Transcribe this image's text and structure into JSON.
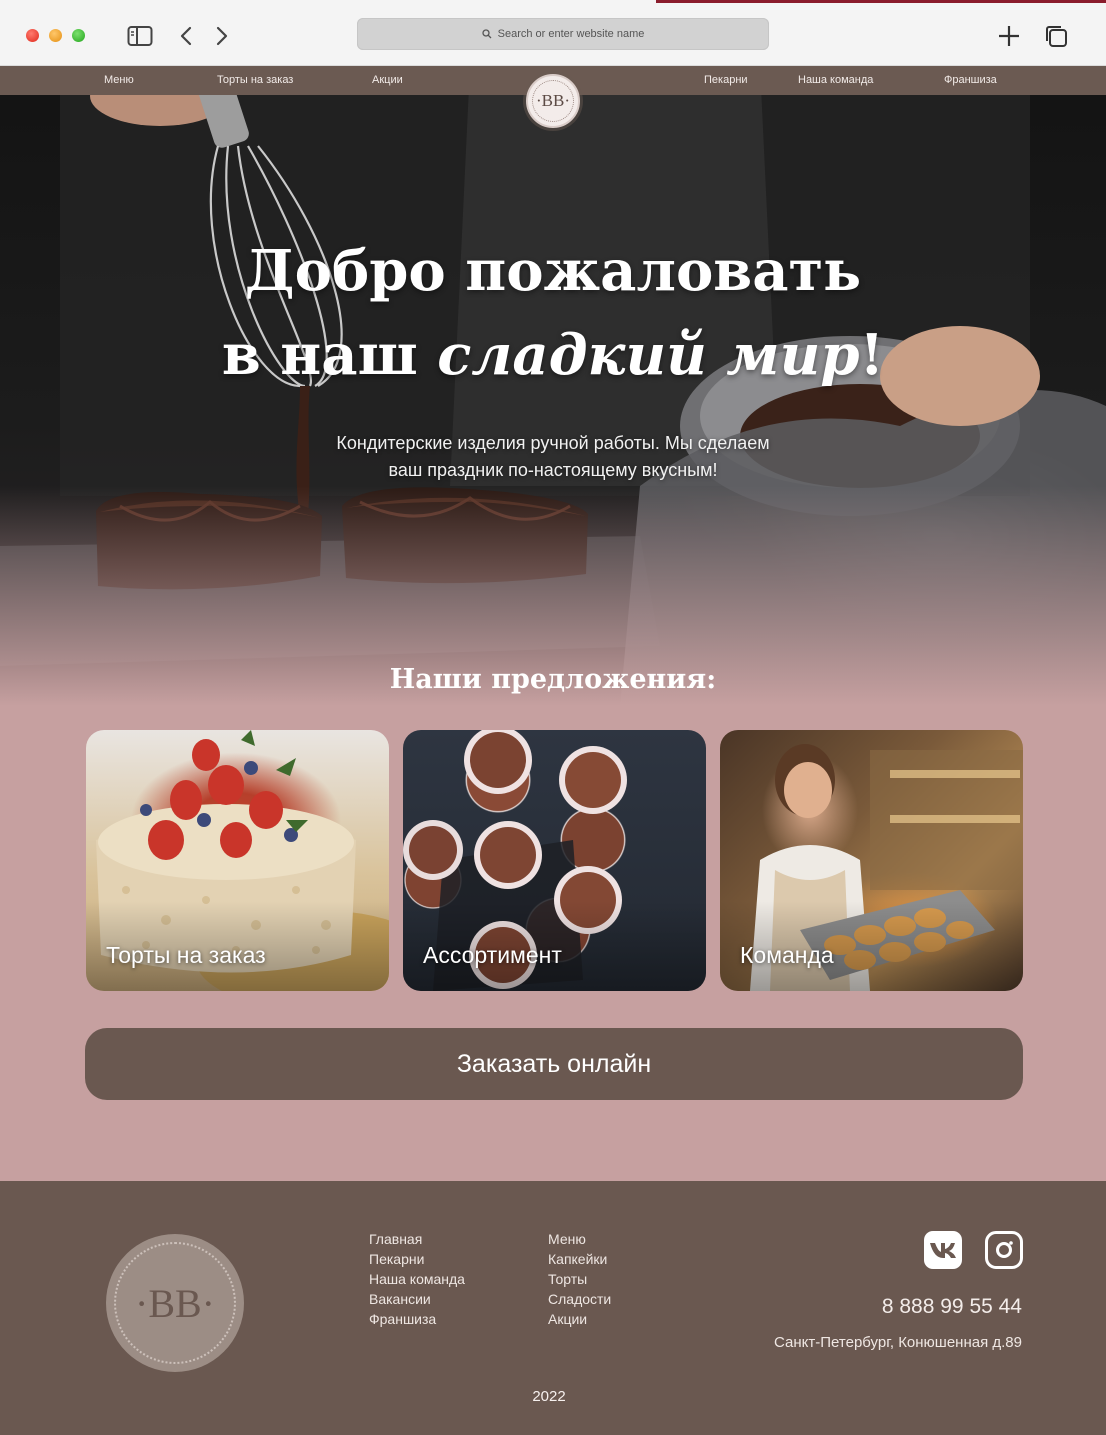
{
  "browser": {
    "url_placeholder": "Search or enter website name",
    "icons": {
      "sidebar": "sidebar-icon",
      "back": "chevron-left-icon",
      "forward": "chevron-right-icon",
      "new_tab": "plus-icon",
      "tabs": "tabs-overview-icon",
      "search": "search-icon"
    }
  },
  "nav": {
    "items": [
      "Меню",
      "Торты на заказ",
      "Акции",
      "Пекарни",
      "Наша команда",
      "Франшиза"
    ],
    "logo_text": "·BB·"
  },
  "hero": {
    "title_line1": "Добро пожаловать",
    "title_line2_regular": "в наш ",
    "title_line2_italic": "сладкий мир",
    "title_line2_end": "!",
    "subtitle_line1": "Кондитерские изделия ручной работы. Мы сделаем",
    "subtitle_line2": "ваш праздник по-настоящему вкусным!"
  },
  "offers": {
    "title": "Наши предложения:",
    "cards": [
      {
        "label": "Торты на заказ"
      },
      {
        "label": "Ассортимент"
      },
      {
        "label": "Команда"
      }
    ]
  },
  "cta": {
    "label": "Заказать онлайн"
  },
  "footer": {
    "logo_text": "·BB·",
    "col1": [
      "Главная",
      "Пекарни",
      "Наша команда",
      "Вакансии",
      "Франшиза"
    ],
    "col2": [
      "Меню",
      "Капкейки",
      "Торты",
      "Сладости",
      "Акции"
    ],
    "phone": "8 888 99 55 44",
    "address": "Санкт-Петербург, Конюшенная д.89",
    "year": "2022",
    "social": [
      "vk-icon",
      "instagram-icon"
    ]
  },
  "colors": {
    "nav_bg": "#6b5a52",
    "page_bg": "#c6a0a0",
    "button_bg": "#6a5850",
    "footer_bg": "#6a5850"
  }
}
